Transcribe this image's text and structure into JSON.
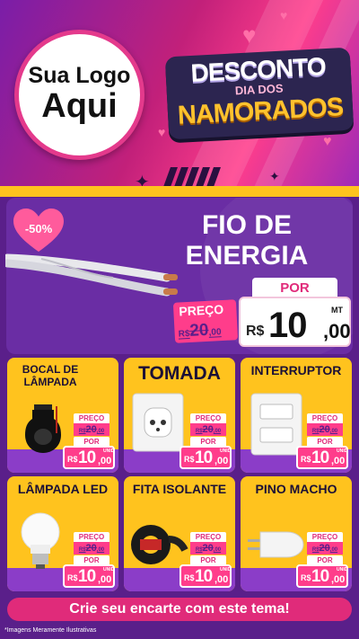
{
  "header": {
    "logo_line1": "Sua Logo",
    "logo_line2": "Aqui",
    "promo_line1": "DESCONTO",
    "promo_line2": "DIA DOS",
    "promo_line3": "NAMORADOS"
  },
  "featured": {
    "discount_badge": "-50%",
    "title_line1": "FIO DE",
    "title_line2": "ENERGIA",
    "preco_label": "PREÇO",
    "old_currency": "R$",
    "old_int": "20",
    "old_cents": ",00",
    "por_label": "POR",
    "currency": "R$",
    "price_int": "10",
    "price_cents": ",00",
    "unit": "MT"
  },
  "products": [
    {
      "title": "BOCAL DE LÂMPADA",
      "preco_label": "PREÇO",
      "old_currency": "R$",
      "old_int": "20",
      "old_cents": ",00",
      "por_label": "POR",
      "currency": "R$",
      "price_int": "10",
      "price_cents": ",00",
      "unit": "UNID",
      "image": "bulb-socket"
    },
    {
      "title": "TOMADA",
      "preco_label": "PREÇO",
      "old_currency": "R$",
      "old_int": "20",
      "old_cents": ",00",
      "por_label": "POR",
      "currency": "R$",
      "price_int": "10",
      "price_cents": ",00",
      "unit": "UNID",
      "image": "power-outlet"
    },
    {
      "title": "INTERRUPTOR",
      "preco_label": "PREÇO",
      "old_currency": "R$",
      "old_int": "20",
      "old_cents": ",00",
      "por_label": "POR",
      "currency": "R$",
      "price_int": "10",
      "price_cents": ",00",
      "unit": "UNID",
      "image": "light-switch"
    },
    {
      "title": "LÂMPADA LED",
      "preco_label": "PREÇO",
      "old_currency": "R$",
      "old_int": "20",
      "old_cents": ",00",
      "por_label": "POR",
      "currency": "R$",
      "price_int": "10",
      "price_cents": ",00",
      "unit": "UNID",
      "image": "led-bulb"
    },
    {
      "title": "FITA ISOLANTE",
      "preco_label": "PREÇO",
      "old_currency": "R$",
      "old_int": "20",
      "old_cents": ",00",
      "por_label": "POR",
      "currency": "R$",
      "price_int": "10",
      "price_cents": ",00",
      "unit": "UNID",
      "image": "insulating-tape"
    },
    {
      "title": "PINO MACHO",
      "preco_label": "PREÇO",
      "old_currency": "R$",
      "old_int": "20",
      "old_cents": ",00",
      "por_label": "POR",
      "currency": "R$",
      "price_int": "10",
      "price_cents": ",00",
      "unit": "UNID",
      "image": "plug-pin"
    }
  ],
  "footer": {
    "cta": "Crie seu encarte com este tema!",
    "disclaimer": "*Imagens Meramente Ilustrativas"
  },
  "colors": {
    "header_pink": "#ff3d8b",
    "header_purple": "#7a1ea8",
    "card_yellow": "#ffc31e",
    "featured_purple": "#6a2da4",
    "price_pink": "#ff3d8b",
    "cta_pink": "#e02b7a"
  }
}
